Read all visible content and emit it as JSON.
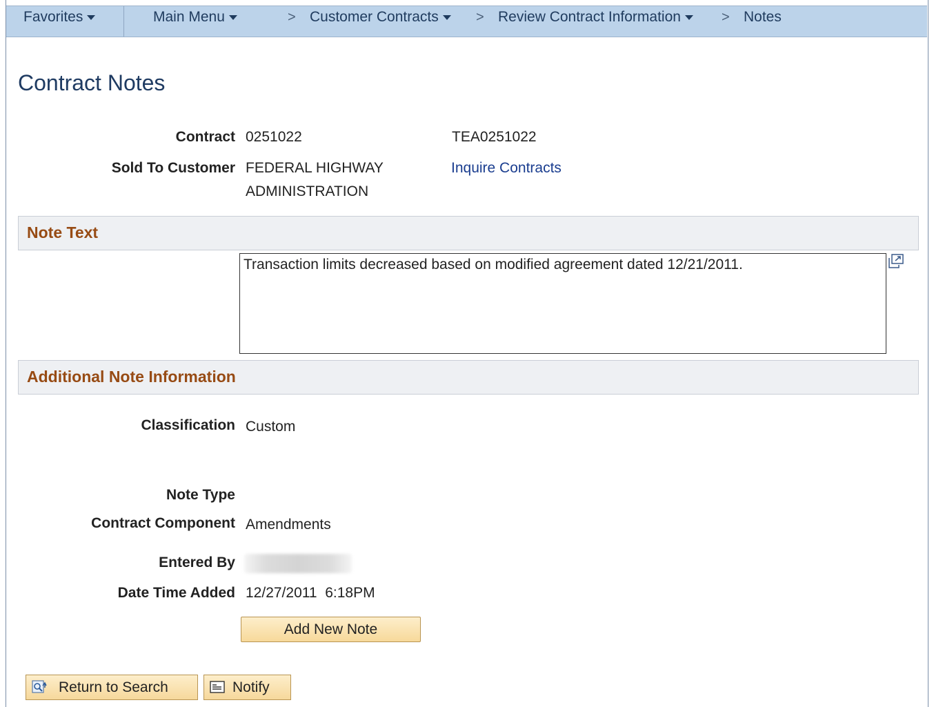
{
  "nav": {
    "favorites": "Favorites",
    "main_menu": "Main Menu",
    "sep": ">",
    "customer_contracts": "Customer Contracts",
    "review_contract": "Review Contract Information",
    "notes": "Notes"
  },
  "page_title": "Contract Notes",
  "header": {
    "contract_label": "Contract",
    "contract_value": "0251022",
    "contract_desc": "TEA0251022",
    "sold_to_label": "Sold To Customer",
    "sold_to_line1": "FEDERAL HIGHWAY",
    "sold_to_line2": "ADMINISTRATION",
    "inquire_link": "Inquire Contracts"
  },
  "note_text": {
    "section_title": "Note Text",
    "value": "Transaction limits decreased based on modified agreement dated 12/21/2011."
  },
  "additional": {
    "section_title": "Additional Note Information",
    "classification_label": "Classification",
    "classification_value": "Custom",
    "note_type_label": "Note Type",
    "component_label": "Contract Component",
    "component_value": "Amendments",
    "entered_by_label": "Entered By",
    "date_label": "Date Time Added",
    "date_value": "12/27/2011  6:18PM",
    "add_button": "Add New Note"
  },
  "footer": {
    "return_button": "Return to Search",
    "notify_button": "Notify"
  },
  "colors": {
    "nav_bg": "#bcd3ea",
    "section_title": "#974b14",
    "title": "#1f3b62",
    "link": "#1a3d8f"
  }
}
